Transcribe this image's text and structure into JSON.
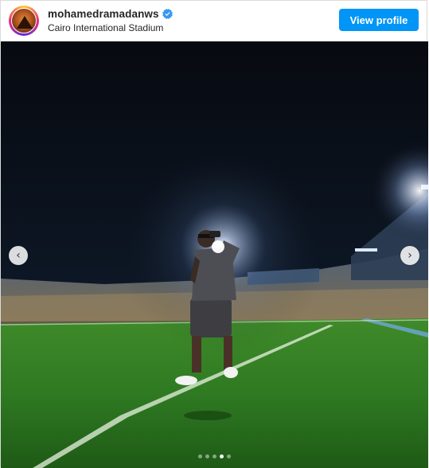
{
  "post": {
    "username": "mohamedramadanws",
    "verified": true,
    "location": "Cairo International Stadium",
    "view_profile_label": "View profile"
  },
  "carousel": {
    "slide_count": 5,
    "active_index": 3,
    "prev_icon": "chevron-left-icon",
    "next_icon": "chevron-right-icon"
  },
  "colors": {
    "accent": "#0095f6",
    "verified": "#3897f0"
  }
}
